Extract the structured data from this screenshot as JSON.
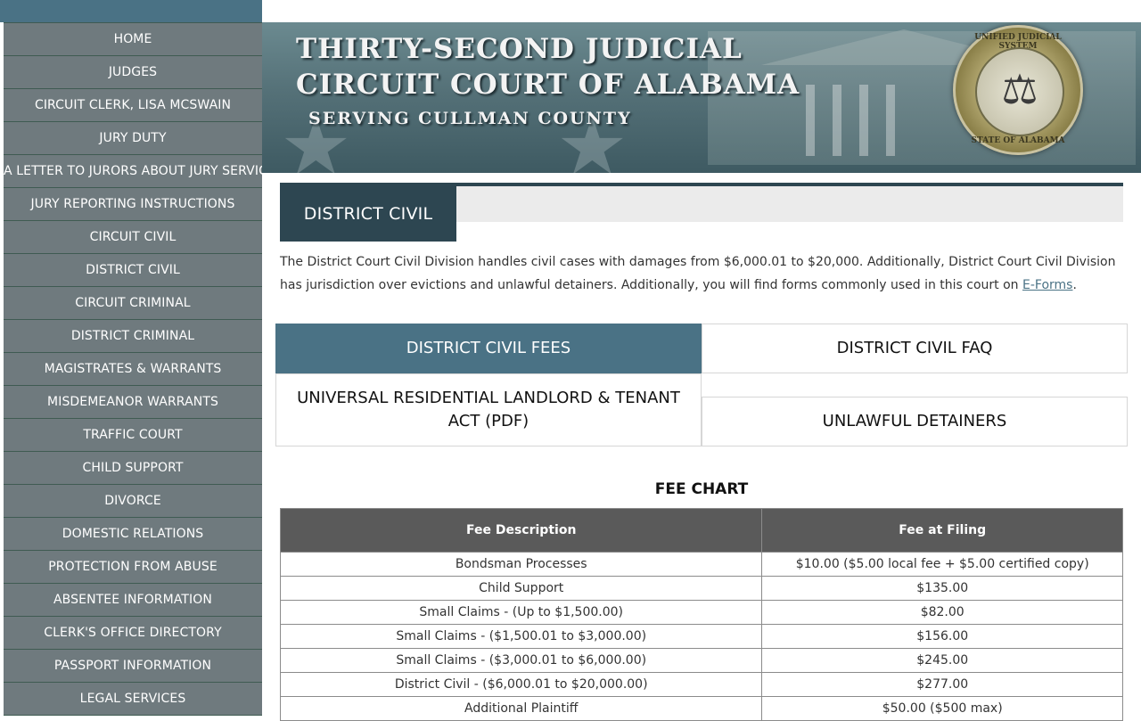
{
  "sidebar": {
    "items": [
      {
        "label": "HOME"
      },
      {
        "label": "JUDGES"
      },
      {
        "label": "CIRCUIT CLERK, LISA MCSWAIN"
      },
      {
        "label": "JURY DUTY"
      },
      {
        "label": "A LETTER TO JURORS ABOUT JURY SERVICE"
      },
      {
        "label": "JURY REPORTING INSTRUCTIONS"
      },
      {
        "label": "CIRCUIT CIVIL"
      },
      {
        "label": "DISTRICT CIVIL"
      },
      {
        "label": "CIRCUIT CRIMINAL"
      },
      {
        "label": "DISTRICT CRIMINAL"
      },
      {
        "label": "MAGISTRATES & WARRANTS"
      },
      {
        "label": "MISDEMEANOR WARRANTS"
      },
      {
        "label": "TRAFFIC COURT"
      },
      {
        "label": "CHILD SUPPORT"
      },
      {
        "label": "DIVORCE"
      },
      {
        "label": "DOMESTIC RELATIONS"
      },
      {
        "label": "PROTECTION FROM ABUSE"
      },
      {
        "label": "ABSENTEE INFORMATION"
      },
      {
        "label": "CLERK'S OFFICE DIRECTORY"
      },
      {
        "label": "PASSPORT INFORMATION"
      },
      {
        "label": "LEGAL SERVICES"
      }
    ]
  },
  "header": {
    "line1": "THIRTY-SECOND JUDICIAL",
    "line2": "CIRCUIT COURT OF ALABAMA",
    "line3": "SERVING CULLMAN COUNTY",
    "seal_top": "UNIFIED JUDICIAL SYSTEM",
    "seal_bottom": "STATE OF ALABAMA"
  },
  "main": {
    "section_title": "DISTRICT CIVIL",
    "intro_text": "The District Court Civil Division handles civil cases with damages from $6,000.01 to $20,000. Additionally, District Court Civil Division has jurisdiction over evictions and unlawful detainers. Additionally, you will find forms commonly used in this court on ",
    "intro_link": "E-Forms",
    "intro_end": ".",
    "tabs": {
      "fees": "DISTRICT CIVIL FEES",
      "faq": "DISTRICT CIVIL FAQ",
      "urlta": "UNIVERSAL RESIDENTIAL LANDLORD & TENANT ACT (PDF)",
      "detainers": "UNLAWFUL DETAINERS"
    },
    "fee_chart": {
      "heading": "FEE CHART",
      "columns": [
        "Fee Description",
        "Fee at Filing"
      ],
      "rows": [
        [
          "Bondsman Processes",
          "$10.00 ($5.00 local fee + $5.00 certified copy)"
        ],
        [
          "Child Support",
          "$135.00"
        ],
        [
          "Small Claims - (Up to $1,500.00)",
          "$82.00"
        ],
        [
          "Small Claims - ($1,500.01 to $3,000.00)",
          "$156.00"
        ],
        [
          "Small Claims - ($3,000.01 to $6,000.00)",
          "$245.00"
        ],
        [
          "District Civil - ($6,000.01 to $20,000.00)",
          "$277.00"
        ],
        [
          "Additional Plaintiff",
          "$50.00 ($500 max)"
        ]
      ]
    }
  },
  "colors": {
    "accent": "#4a7285",
    "dark_accent": "#2d4651",
    "nav_bg": "#6f7a7e",
    "table_header": "#5a5a5a"
  }
}
